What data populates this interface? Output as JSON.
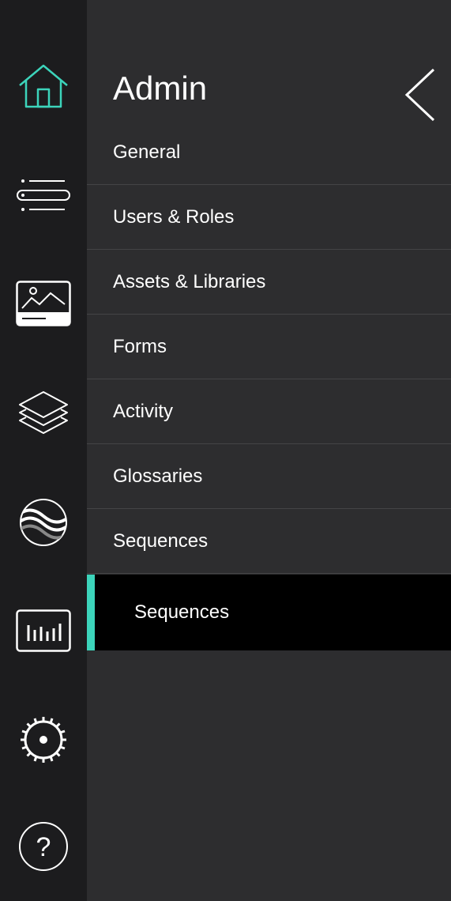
{
  "colors": {
    "accent": "#3cd4bb",
    "rail_bg": "#1c1c1e",
    "panel_bg": "#2d2d2f",
    "active_bg": "#000000"
  },
  "rail": {
    "icons": [
      "home-icon",
      "list-icon",
      "image-icon",
      "layers-icon",
      "waves-icon",
      "bar-chart-icon",
      "settings-icon",
      "help-icon"
    ]
  },
  "panel": {
    "title": "Admin",
    "close_icon": "chevron-left-icon",
    "items": [
      {
        "label": "General"
      },
      {
        "label": "Users & Roles"
      },
      {
        "label": "Assets & Libraries"
      },
      {
        "label": "Forms"
      },
      {
        "label": "Activity"
      },
      {
        "label": "Glossaries"
      },
      {
        "label": "Sequences"
      }
    ],
    "active_sub_item": {
      "label": "Sequences"
    }
  }
}
